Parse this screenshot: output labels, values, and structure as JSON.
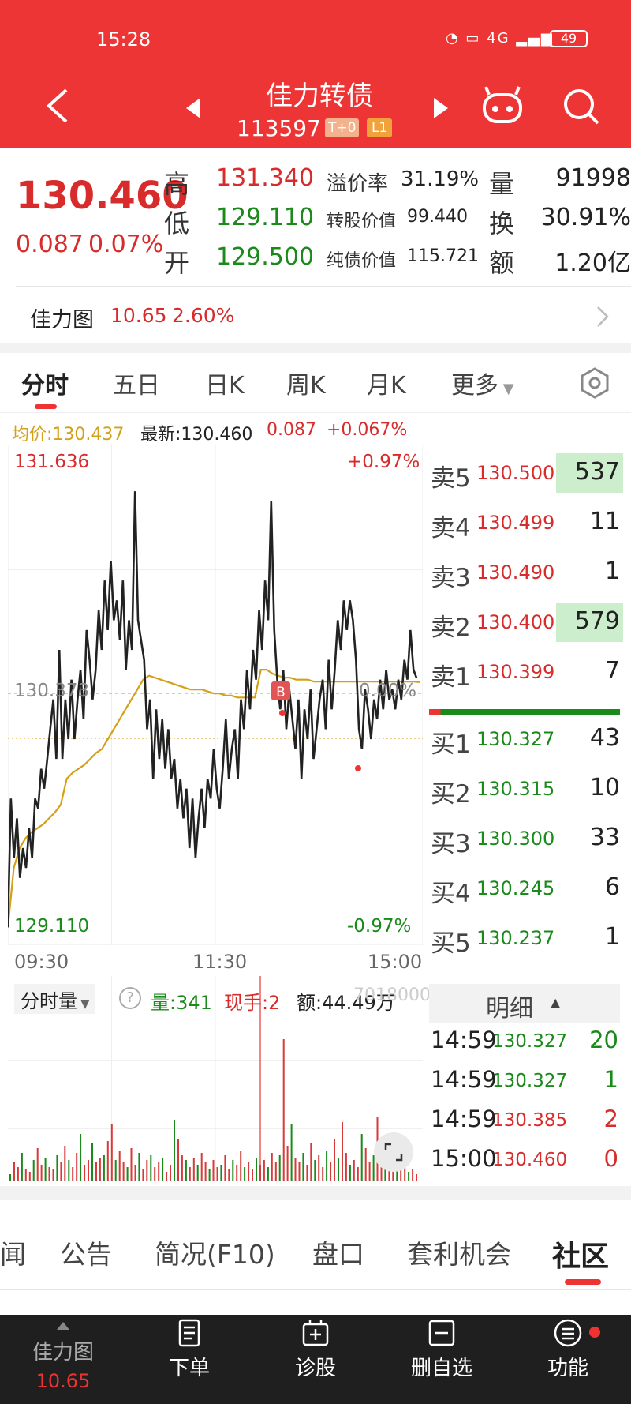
{
  "status_bar": {
    "time": "15:28",
    "battery": "49",
    "network": "4G"
  },
  "header": {
    "title": "佳力转债",
    "code": "113597",
    "badge_t0": "T+0",
    "badge_l1": "L1"
  },
  "quote": {
    "price": "130.460",
    "change": "0.087",
    "change_pct": "0.07%",
    "high_label": "高",
    "high": "131.340",
    "low_label": "低",
    "low": "129.110",
    "open_label": "开",
    "open": "129.500",
    "premium_label": "溢价率",
    "premium": "31.19%",
    "conv_value_label": "转股价值",
    "conv_value": "99.440",
    "bond_value_label": "纯债价值",
    "bond_value": "115.721",
    "vol_label": "量",
    "vol": "91998",
    "turnover_label": "换",
    "turnover": "30.91%",
    "amount_label": "额",
    "amount": "1.20亿"
  },
  "underlying": {
    "name": "佳力图",
    "price": "10.65",
    "pct": "2.60%"
  },
  "tabs": [
    "分时",
    "五日",
    "日K",
    "周K",
    "月K",
    "更多"
  ],
  "chart_info": {
    "avg_label": "均价:130.437",
    "latest_label": "最新:130.460",
    "change": "0.087",
    "change_pct": "+0.067%"
  },
  "chart_axis": {
    "top_left": "131.636",
    "top_right": "+0.97%",
    "bottom_left": "129.110",
    "bottom_right": "-0.97%",
    "mid_left": "130.373",
    "mid_right": "0.00%",
    "time_start": "09:30",
    "time_mid": "11:30",
    "time_end": "15:00",
    "marker_b": "B"
  },
  "volume_info": {
    "selector": "分时量",
    "help": "?",
    "vol_label": "量:341",
    "hand_label": "现手:2",
    "amount_label": "额:44.49万",
    "scale": "7018000"
  },
  "order_book": {
    "sells": [
      {
        "label": "卖5",
        "price": "130.500",
        "vol": "537",
        "hl": true
      },
      {
        "label": "卖4",
        "price": "130.499",
        "vol": "11",
        "hl": false
      },
      {
        "label": "卖3",
        "price": "130.490",
        "vol": "1",
        "hl": false
      },
      {
        "label": "卖2",
        "price": "130.400",
        "vol": "579",
        "hl": true
      },
      {
        "label": "卖1",
        "price": "130.399",
        "vol": "7",
        "hl": false
      }
    ],
    "buys": [
      {
        "label": "买1",
        "price": "130.327",
        "vol": "43"
      },
      {
        "label": "买2",
        "price": "130.315",
        "vol": "10"
      },
      {
        "label": "买3",
        "price": "130.300",
        "vol": "33"
      },
      {
        "label": "买4",
        "price": "130.245",
        "vol": "6"
      },
      {
        "label": "买5",
        "price": "130.237",
        "vol": "1"
      }
    ]
  },
  "details": {
    "title": "明细",
    "rows": [
      {
        "time": "14:59",
        "price": "130.327",
        "price_color": "grn",
        "vol": "20",
        "vol_color": "grn"
      },
      {
        "time": "14:59",
        "price": "130.327",
        "price_color": "grn",
        "vol": "1",
        "vol_color": "grn"
      },
      {
        "time": "14:59",
        "price": "130.385",
        "price_color": "red",
        "vol": "2",
        "vol_color": "red"
      },
      {
        "time": "15:00",
        "price": "130.460",
        "price_color": "red",
        "vol": "0",
        "vol_color": "red"
      }
    ]
  },
  "bottom_tabs": [
    "闻",
    "公告",
    "简况(F10)",
    "盘口",
    "套利机会",
    "社区"
  ],
  "nav": [
    {
      "label": "佳力图",
      "sub": "10.65",
      "icon": "stock-icon"
    },
    {
      "label": "下单",
      "icon": "order-icon"
    },
    {
      "label": "诊股",
      "icon": "diagnose-icon"
    },
    {
      "label": "删自选",
      "icon": "remove-watchlist-icon"
    },
    {
      "label": "功能",
      "icon": "menu-icon"
    }
  ],
  "colors": {
    "header": "#ee3535",
    "up": "#d82b2b",
    "down": "#1a8a1a",
    "avg": "#d4a017"
  },
  "chart_data": {
    "type": "line",
    "x_range": [
      "09:30",
      "15:00"
    ],
    "ylim": [
      129.11,
      131.636
    ],
    "prev_close": 130.373,
    "series": [
      {
        "name": "最新",
        "values": [
          129.2,
          129.85,
          129.55,
          129.75,
          129.45,
          129.6,
          129.5,
          129.7,
          129.55,
          129.85,
          129.8,
          130.0,
          129.9,
          130.05,
          130.2,
          130.35,
          130.05,
          130.6,
          130.05,
          130.35,
          130.15,
          130.45,
          130.15,
          130.35,
          130.5,
          130.25,
          130.7,
          130.55,
          130.35,
          130.5,
          130.8,
          130.6,
          130.95,
          130.7,
          131.05,
          130.75,
          130.85,
          130.65,
          130.95,
          130.5,
          130.75,
          130.6,
          131.4,
          130.75,
          130.65,
          130.55,
          130.2,
          130.35,
          129.95,
          130.3,
          130.05,
          130.25,
          130.0,
          130.2,
          129.95,
          130.05,
          129.8,
          129.95,
          129.75,
          129.9,
          129.6,
          129.85,
          129.55,
          129.75,
          129.9,
          129.7,
          129.95,
          129.85,
          130.1,
          129.9,
          129.8,
          130.0,
          130.25,
          129.95,
          130.1,
          130.2,
          129.95,
          130.35,
          130.2,
          130.5,
          130.3,
          130.6,
          130.45,
          130.8,
          130.6,
          130.95,
          130.75,
          131.35,
          130.7,
          130.45,
          130.3,
          130.5,
          130.2,
          130.4,
          130.25,
          130.1,
          130.35,
          129.95,
          130.3,
          130.15,
          130.4,
          130.05,
          130.2,
          130.35,
          130.45,
          130.2,
          130.55,
          130.3,
          130.5,
          130.75,
          130.6,
          130.85,
          130.7,
          130.85,
          130.75,
          130.55,
          130.2,
          130.1,
          130.4,
          130.3,
          130.15,
          130.35,
          130.25,
          130.45,
          130.3,
          130.5,
          130.35,
          130.4,
          130.3,
          130.45,
          130.35,
          130.55,
          130.45,
          130.7,
          130.5,
          130.46
        ]
      },
      {
        "name": "均价",
        "values": [
          129.2,
          129.5,
          129.6,
          129.65,
          129.68,
          129.7,
          129.72,
          129.75,
          129.78,
          129.82,
          129.95,
          129.98,
          130.0,
          130.02,
          130.05,
          130.08,
          130.1,
          130.15,
          130.2,
          130.25,
          130.3,
          130.35,
          130.4,
          130.45,
          130.47,
          130.46,
          130.45,
          130.44,
          130.43,
          130.42,
          130.41,
          130.4,
          130.4,
          130.4,
          130.39,
          130.38,
          130.38,
          130.37,
          130.37,
          130.36,
          130.36,
          130.36,
          130.36,
          130.5,
          130.5,
          130.48,
          130.47,
          130.46,
          130.46,
          130.45,
          130.45,
          130.45,
          130.44,
          130.44,
          130.44,
          130.44,
          130.44,
          130.44,
          130.44,
          130.44,
          130.44,
          130.44,
          130.44,
          130.44,
          130.44,
          130.44,
          130.44,
          130.44,
          130.44,
          130.44,
          130.437
        ]
      }
    ],
    "volume": {
      "bars": [
        3,
        8,
        6,
        12,
        5,
        4,
        9,
        14,
        7,
        10,
        6,
        5,
        11,
        8,
        15,
        9,
        6,
        12,
        20,
        7,
        9,
        16,
        8,
        10,
        11,
        17,
        24,
        9,
        13,
        8,
        6,
        14,
        7,
        12,
        5,
        9,
        11,
        6,
        8,
        10,
        4,
        7,
        26,
        18,
        11,
        9,
        6,
        10,
        7,
        12,
        8,
        5,
        9,
        6,
        7,
        11,
        5,
        9,
        7,
        13,
        6,
        8,
        5,
        10,
        7,
        9,
        6,
        12,
        8,
        11,
        60,
        15,
        24,
        10,
        8,
        12,
        7,
        16,
        9,
        11,
        6,
        13,
        8,
        18,
        10,
        25,
        12,
        7,
        9,
        6,
        20,
        14,
        8,
        11,
        27,
        10,
        12,
        7,
        9,
        14,
        6,
        8,
        4,
        5,
        3
      ],
      "colors_up_down": "mixed"
    }
  }
}
